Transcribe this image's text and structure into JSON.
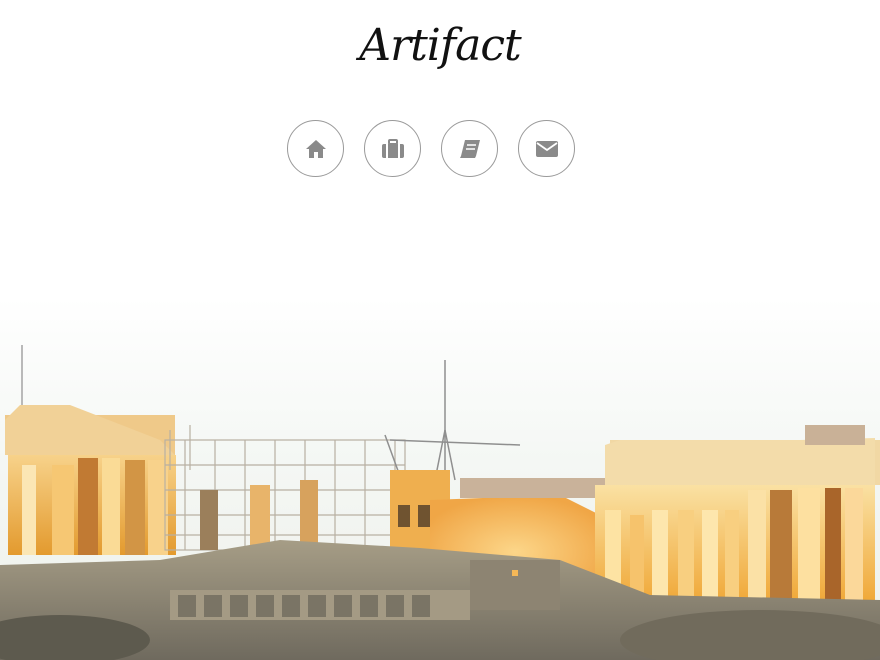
{
  "site": {
    "logo_text": "Artifact"
  },
  "nav": {
    "items": [
      {
        "icon": "home-icon"
      },
      {
        "icon": "briefcase-icon"
      },
      {
        "icon": "book-icon"
      },
      {
        "icon": "envelope-icon"
      }
    ]
  },
  "hero": {
    "subject": "acropolis-parthenon-photo"
  },
  "colors": {
    "icon": "#8a8a8a",
    "button_border": "#9a9a9a",
    "sky_top": "#ffffff",
    "sky_bottom": "#f1f4f1",
    "temple_glow": "#f6b640",
    "rock": "#8f8a78"
  }
}
